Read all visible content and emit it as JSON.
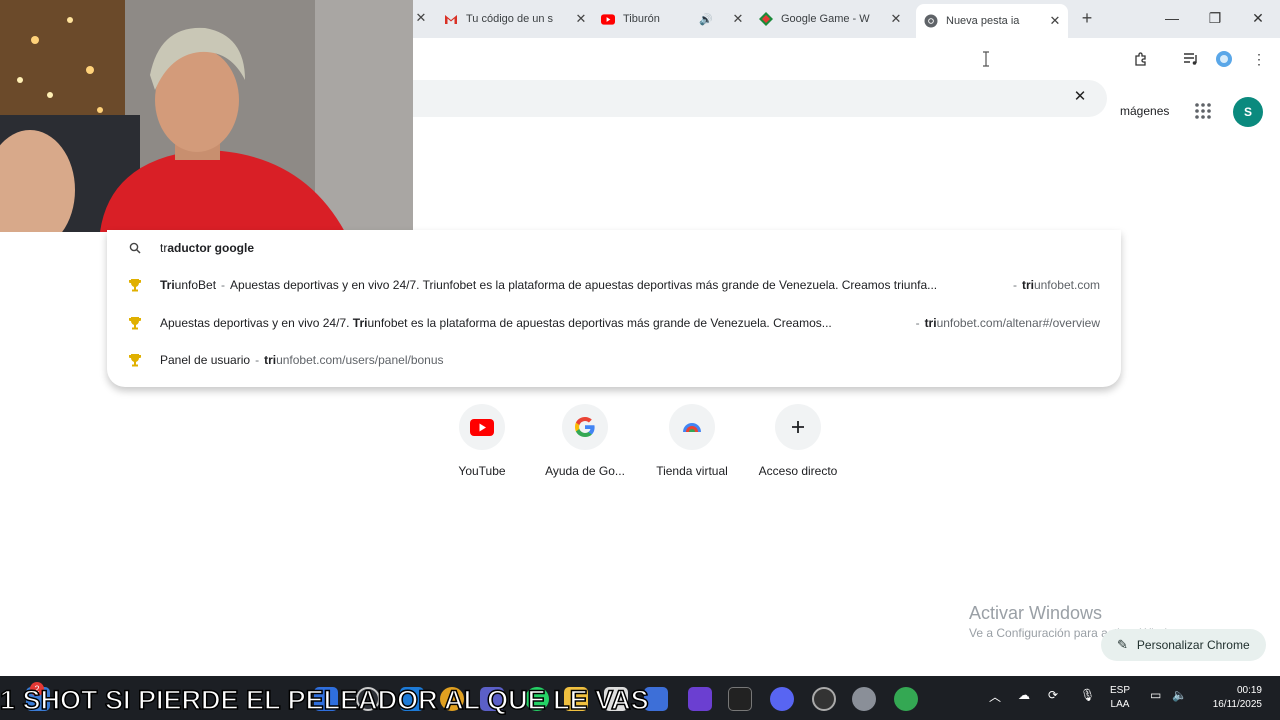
{
  "tabs": [
    {
      "title": "Tu código de un s",
      "favicon": "gmail-icon",
      "color": "#d93025"
    },
    {
      "title": "Tiburón",
      "favicon": "youtube-icon",
      "color": "#ff0000",
      "sound": "🔊"
    },
    {
      "title": "Google Game - W",
      "favicon": "game-icon",
      "color": "#1b8a3a"
    },
    {
      "title": "Nueva pesta ia",
      "favicon": "chrome-icon",
      "color": "#5f6368",
      "active": true
    }
  ],
  "omnibox": {
    "clear_icon": "close-icon"
  },
  "ntp": {
    "images_link": "mágenes",
    "avatar_letter": "S",
    "avatar_color": "#0b8a7e"
  },
  "suggestions": [
    {
      "type": "search",
      "icon": "search-icon",
      "prefix": "tr",
      "bold": "aductor google"
    },
    {
      "type": "history",
      "icon": "trophy-icon",
      "title_bold": "Tri",
      "title_rest": "unfoBet",
      "desc": "Apuestas deportivas y en vivo 24/7. Triunfobet es la plataforma de apuestas deportivas más grande de Venezuela. Creamos triunfa...",
      "url_bold": "tri",
      "url_rest": "unfobet.com"
    },
    {
      "type": "history",
      "icon": "trophy-icon",
      "pre": "Apuestas deportivas y en vivo 24/7.",
      "mid_bold": "Tri",
      "mid_rest": "unfobet es la plataforma de apuestas deportivas más grande de Venezuela. Creamos...",
      "url_bold": "tri",
      "url_rest": "unfobet.com/altenar#/overview"
    },
    {
      "type": "history",
      "icon": "trophy-icon",
      "title": "Panel de usuario",
      "url_bold": "tri",
      "url_rest": "unfobet.com/users/panel/bonus"
    }
  ],
  "shortcuts": [
    {
      "label": "YouTube",
      "icon": "youtube-icon"
    },
    {
      "label": "Ayuda de Go...",
      "icon": "google-icon"
    },
    {
      "label": "Tienda virtual",
      "icon": "store-icon"
    },
    {
      "label": "Acceso directo",
      "icon": "plus-icon"
    }
  ],
  "activate_windows": {
    "line1": "Activar Windows",
    "line2": "Ve a Configuración para activar Windows."
  },
  "customize_button": "Personalizar Chrome",
  "taskbar": {
    "language": "ESP",
    "layout": "LAA",
    "time": "00:19",
    "date": "16/11/2025",
    "badge_count": "2"
  },
  "caption": "1 SHOT SI PIERDE EL PELEADOR AL QUE LE VAS"
}
